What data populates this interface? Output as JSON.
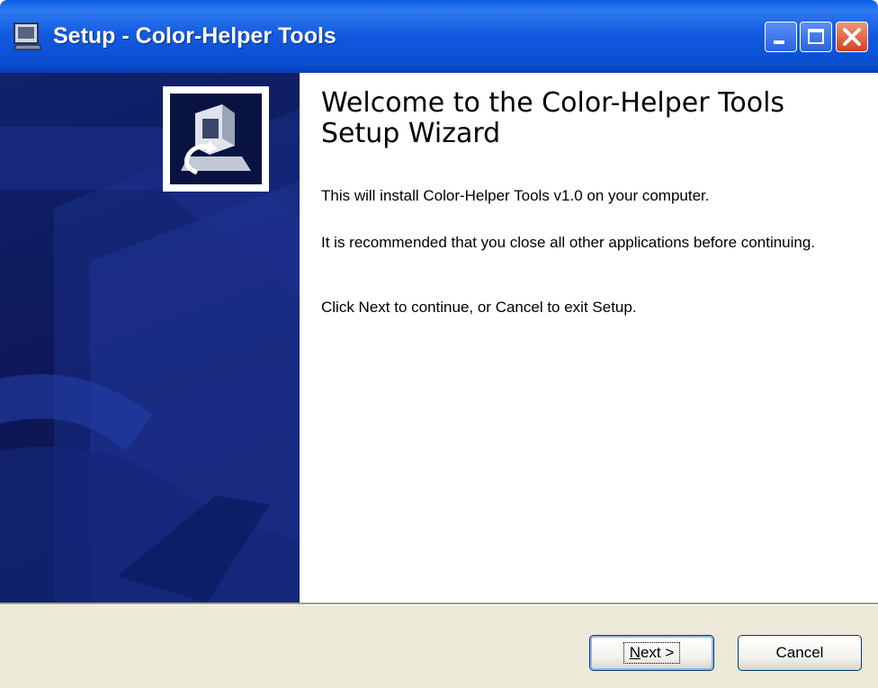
{
  "window": {
    "title": "Setup - Color-Helper Tools",
    "icon": "setup-app-icon",
    "controls": [
      "minimize-icon",
      "maximize-icon",
      "close-icon"
    ]
  },
  "side_panel": {
    "background_color": "#0e1a5c",
    "icon": "install-computer-icon"
  },
  "content": {
    "title": "Welcome to the Color-Helper Tools Setup Wizard",
    "paragraphs": [
      "This will install Color-Helper Tools v1.0 on your computer.",
      "It is recommended that you close all other applications before continuing.",
      "Click Next to continue, or Cancel to exit Setup."
    ]
  },
  "buttons": {
    "next": {
      "accelerator": "N",
      "rest": "ext >",
      "label": "Next >"
    },
    "cancel": {
      "label": "Cancel"
    }
  },
  "colors": {
    "titlebar": "#0a54e0",
    "footer": "#ece9d8",
    "close_button": "#d2431e"
  }
}
